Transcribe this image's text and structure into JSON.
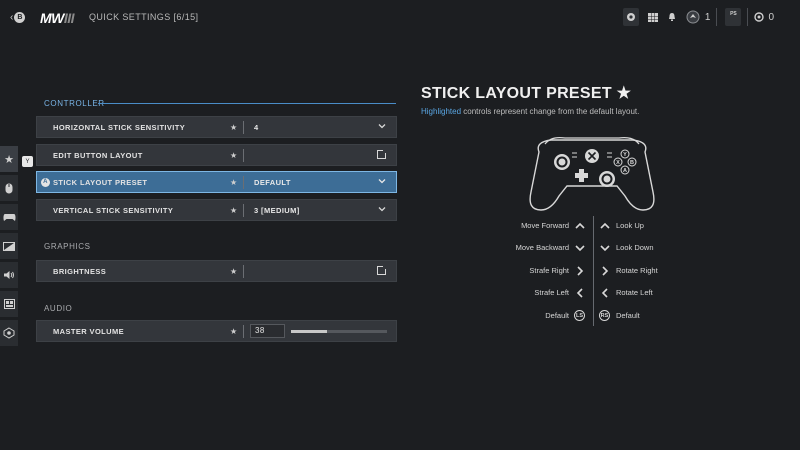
{
  "topbar": {
    "back_badge": "B",
    "logo_main": "MW",
    "logo_suffix": "III",
    "breadcrumb": "QUICK SETTINGS [6/15]",
    "icons": [
      "headset-icon",
      "grid-icon",
      "bell-icon",
      "player-level-icon",
      "profile-icon",
      "currency-icon"
    ],
    "player_count": "1",
    "currency": "0",
    "profile_badge": "PS"
  },
  "rail": {
    "icons": [
      "star-icon",
      "mouse-icon",
      "gamepad-icon",
      "graphics-icon",
      "audio-icon",
      "interface-icon",
      "network-icon"
    ],
    "tag": "Y"
  },
  "sections": {
    "controller": "CONTROLLER",
    "graphics": "GRAPHICS",
    "audio": "AUDIO"
  },
  "rows": {
    "hss": {
      "label": "HORIZONTAL STICK SENSITIVITY",
      "value": "4"
    },
    "ebl": {
      "label": "EDIT BUTTON LAYOUT"
    },
    "slp": {
      "label": "STICK LAYOUT PRESET",
      "value": "DEFAULT",
      "badge": "A"
    },
    "vss": {
      "label": "VERTICAL STICK SENSITIVITY",
      "value": "3 [MEDIUM]"
    },
    "brightness": {
      "label": "BRIGHTNESS"
    },
    "master_volume": {
      "label": "MASTER VOLUME",
      "value": "38",
      "level": 0.38
    }
  },
  "star_glyph": "★",
  "panel": {
    "title": "STICK LAYOUT PRESET",
    "title_star": "★",
    "subtitle_highlight": "Highlighted",
    "subtitle_rest": " controls represent change from the default layout.",
    "controller_labels": {
      "y": "Y",
      "x": "X",
      "b": "B",
      "a": "A"
    },
    "left_mappings": [
      "Move Forward",
      "Move Backward",
      "Strafe Right",
      "Strafe Left",
      "Default"
    ],
    "right_mappings": [
      "Look Up",
      "Look Down",
      "Rotate Right",
      "Rotate Left",
      "Default"
    ],
    "left_stick_badge": "LS",
    "right_stick_badge": "RS"
  },
  "colors": {
    "accent": "#4a8dc8",
    "highlight_row": "#3d6d96",
    "background": "#1c1e21"
  }
}
